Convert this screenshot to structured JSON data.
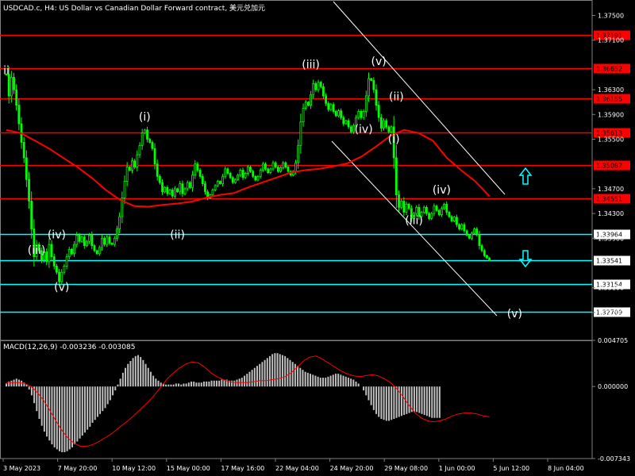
{
  "chart_data": [
    {
      "type": "candlestick",
      "title": "USDCAD.c, H4:  US Dollar vs Canadian Dollar Forward contract, 美元兑加元",
      "ylim": [
        1.3225,
        1.3775
      ],
      "y_ticks": [
        "1.37500",
        "1.37100",
        "1.36300",
        "1.35900",
        "1.35500",
        "1.34700",
        "1.34300",
        "1.33900",
        "1.33100",
        "1.32700"
      ],
      "x_ticks": [
        "3 May 2023",
        "7 May 20:00",
        "10 May 12:00",
        "15 May 00:00",
        "17 May 16:00",
        "22 May 04:00",
        "24 May 20:00",
        "29 May 08:00",
        "1 Jun 00:00",
        "5 Jun 12:00",
        "8 Jun 04:00"
      ],
      "colors": {
        "bull": "#00ff00",
        "bear": "#00ff00",
        "ma": "#ff0000",
        "red_level": "#ff0000",
        "cyan_level": "#00ffff",
        "arrow": "#00ffff",
        "trend": "#ffffff"
      },
      "h_levels": [
        {
          "value": 1.37191,
          "label": "1.37191",
          "color": "red"
        },
        {
          "value": 1.36652,
          "label": "1.36652",
          "color": "red"
        },
        {
          "value": 1.36155,
          "label": "1.36155",
          "color": "red"
        },
        {
          "value": 1.35613,
          "label": "1.35613",
          "color": "red"
        },
        {
          "value": 1.35087,
          "label": "1.35087",
          "color": "red"
        },
        {
          "value": 1.34551,
          "label": "1.34551",
          "color": "red"
        },
        {
          "value": 1.33964,
          "label": "1.33964",
          "color": "cyan"
        },
        {
          "value": 1.33541,
          "label": "1.33541",
          "color": "cyan"
        },
        {
          "value": 1.33154,
          "label": "1.33154",
          "color": "cyan"
        },
        {
          "value": 1.32709,
          "label": "1.32709",
          "color": "cyan"
        }
      ],
      "wave_labels": [
        {
          "text": "ii",
          "bar": 0,
          "price": 1.3655
        },
        {
          "text": "(i)",
          "bar": 55,
          "price": 1.358
        },
        {
          "text": "(ii)",
          "bar": 68,
          "price": 1.339
        },
        {
          "text": "(iii)",
          "bar": 12,
          "price": 1.3365
        },
        {
          "text": "(iv)",
          "bar": 20,
          "price": 1.339
        },
        {
          "text": "(v)",
          "bar": 22,
          "price": 1.3305
        },
        {
          "text": "(iii)",
          "bar": 121,
          "price": 1.3665
        },
        {
          "text": "(v)",
          "bar": 148,
          "price": 1.367
        },
        {
          "text": "(iv)",
          "bar": 142,
          "price": 1.356
        },
        {
          "text": "(ii)",
          "bar": 155,
          "price": 1.3613
        },
        {
          "text": "(i)",
          "bar": 154,
          "price": 1.3544
        },
        {
          "text": "(iv)",
          "bar": 173,
          "price": 1.3462
        },
        {
          "text": "(iii)",
          "bar": 162,
          "price": 1.3413
        },
        {
          "text": "(v)",
          "bar": 202,
          "price": 1.3262
        }
      ],
      "closes": [
        1.3655,
        1.362,
        1.365,
        1.363,
        1.3605,
        1.3575,
        1.3545,
        1.352,
        1.3485,
        1.345,
        1.3405,
        1.336,
        1.338,
        1.337,
        1.3355,
        1.3368,
        1.3352,
        1.338,
        1.336,
        1.3345,
        1.3335,
        1.332,
        1.3335,
        1.3345,
        1.336,
        1.3372,
        1.3365,
        1.338,
        1.3395,
        1.3385,
        1.3392,
        1.3378,
        1.3385,
        1.3395,
        1.3378,
        1.337,
        1.3365,
        1.3375,
        1.339,
        1.338,
        1.3392,
        1.3382,
        1.338,
        1.339,
        1.3405,
        1.3425,
        1.3455,
        1.3482,
        1.3505,
        1.35,
        1.3515,
        1.3505,
        1.3525,
        1.354,
        1.356,
        1.3565,
        1.355,
        1.3545,
        1.3535,
        1.351,
        1.349,
        1.348,
        1.3465,
        1.3472,
        1.3462,
        1.3468,
        1.3458,
        1.347,
        1.3465,
        1.3478,
        1.3462,
        1.347,
        1.348,
        1.3472,
        1.3492,
        1.351,
        1.35,
        1.349,
        1.3478,
        1.3465,
        1.3455,
        1.346,
        1.3468,
        1.3475,
        1.3482,
        1.3478,
        1.349,
        1.3502,
        1.3495,
        1.3488,
        1.348,
        1.3485,
        1.3492,
        1.35,
        1.3488,
        1.3495,
        1.3505,
        1.3498,
        1.349,
        1.3484,
        1.349,
        1.35,
        1.351,
        1.3502,
        1.3496,
        1.3502,
        1.3512,
        1.3505,
        1.3498,
        1.3504,
        1.3512,
        1.3505,
        1.3498,
        1.3492,
        1.3498,
        1.3512,
        1.354,
        1.3578,
        1.36,
        1.361,
        1.3605,
        1.3622,
        1.364,
        1.363,
        1.3642,
        1.3635,
        1.362,
        1.3608,
        1.3598,
        1.3606,
        1.3595,
        1.3588,
        1.3596,
        1.3585,
        1.3575,
        1.358,
        1.357,
        1.3562,
        1.3572,
        1.3585,
        1.3595,
        1.3585,
        1.3595,
        1.362,
        1.3648,
        1.3645,
        1.363,
        1.3605,
        1.3585,
        1.3568,
        1.358,
        1.357,
        1.3562,
        1.357,
        1.352,
        1.346,
        1.344,
        1.345,
        1.3432,
        1.3445,
        1.3438,
        1.3422,
        1.343,
        1.344,
        1.3425,
        1.3432,
        1.344,
        1.343,
        1.3422,
        1.343,
        1.3442,
        1.3435,
        1.3428,
        1.3438,
        1.3445,
        1.3432,
        1.3425,
        1.3418,
        1.3424,
        1.3412,
        1.3405,
        1.3412,
        1.3402,
        1.3395,
        1.339,
        1.3398,
        1.3405,
        1.3396,
        1.3378,
        1.337,
        1.3362,
        1.3358,
        1.3354
      ],
      "ma_series": [
        1.3565,
        1.356,
        1.3548,
        1.3535,
        1.352,
        1.3505,
        1.3488,
        1.3468,
        1.3452,
        1.3442,
        1.3441,
        1.3444,
        1.3446,
        1.3449,
        1.3455,
        1.346,
        1.3463,
        1.3472,
        1.348,
        1.3488,
        1.3496,
        1.35,
        1.3502,
        1.3506,
        1.3511,
        1.3522,
        1.3538,
        1.3555,
        1.3565,
        1.356,
        1.3548,
        1.352,
        1.35,
        1.3482,
        1.3458
      ]
    },
    {
      "type": "bar",
      "title": "MACD(12,26,9) -0.003236 -0.003085",
      "ylim": [
        -0.007343,
        0.004705
      ],
      "y_ticks": [
        "0.004705",
        "0.000000",
        "-0.007343"
      ],
      "signal_color": "#ff0000",
      "hist_color": "#c0c0c0",
      "values": [
        0.0003,
        0.0005,
        0.0006,
        0.0007,
        0.0008,
        0.0007,
        0.0006,
        0.0004,
        0.0002,
        -0.0003,
        -0.0009,
        -0.0017,
        -0.0025,
        -0.0033,
        -0.004,
        -0.0046,
        -0.0051,
        -0.0055,
        -0.0059,
        -0.0062,
        -0.0064,
        -0.0066,
        -0.0067,
        -0.0067,
        -0.0066,
        -0.0064,
        -0.0062,
        -0.0059,
        -0.0056,
        -0.0053,
        -0.005,
        -0.0047,
        -0.0044,
        -0.0041,
        -0.0037,
        -0.0034,
        -0.0031,
        -0.0028,
        -0.0025,
        -0.0022,
        -0.0018,
        -0.0014,
        -0.0009,
        -0.0004,
        0.0002,
        0.0008,
        0.0014,
        0.0019,
        0.0023,
        0.0026,
        0.0029,
        0.0031,
        0.0032,
        0.003,
        0.0027,
        0.0023,
        0.0019,
        0.0015,
        0.0011,
        0.0008,
        0.0006,
        0.0004,
        0.0003,
        0.0002,
        0.0002,
        0.0002,
        0.0002,
        0.0003,
        0.0003,
        0.0002,
        0.0003,
        0.0003,
        0.0004,
        0.0005,
        0.0005,
        0.0004,
        0.0004,
        0.0004,
        0.0005,
        0.0005,
        0.0005,
        0.0006,
        0.0006,
        0.0006,
        0.0006,
        0.0007,
        0.0007,
        0.0007,
        0.0006,
        0.0006,
        0.0006,
        0.0007,
        0.0008,
        0.0009,
        0.0011,
        0.0013,
        0.0015,
        0.0017,
        0.0019,
        0.0021,
        0.0023,
        0.0025,
        0.0027,
        0.0029,
        0.0031,
        0.0033,
        0.0034,
        0.0034,
        0.0033,
        0.0032,
        0.0031,
        0.0029,
        0.0027,
        0.0025,
        0.0023,
        0.0021,
        0.0019,
        0.0017,
        0.0015,
        0.0014,
        0.0013,
        0.0012,
        0.0011,
        0.001,
        0.0009,
        0.0009,
        0.0009,
        0.001,
        0.0011,
        0.0012,
        0.0013,
        0.0013,
        0.0012,
        0.0011,
        0.001,
        0.0009,
        0.0008,
        0.0007,
        0.0005,
        0.0003,
        0.0,
        -0.0004,
        -0.0009,
        -0.0014,
        -0.0019,
        -0.0024,
        -0.0028,
        -0.0031,
        -0.0033,
        -0.0034,
        -0.0035,
        -0.0035,
        -0.0034,
        -0.0033,
        -0.0032,
        -0.0031,
        -0.003,
        -0.0029,
        -0.0028,
        -0.0027,
        -0.0026,
        -0.0026,
        -0.0026,
        -0.0027,
        -0.0028,
        -0.0029,
        -0.003,
        -0.0031,
        -0.0032,
        -0.0032,
        -0.0032,
        -0.0032
      ],
      "signal": [
        0.0004,
        0.0004,
        0.0004,
        0.0003,
        0.0,
        -0.0006,
        -0.0014,
        -0.0024,
        -0.0035,
        -0.0045,
        -0.0053,
        -0.0058,
        -0.0061,
        -0.0061,
        -0.0059,
        -0.0056,
        -0.0052,
        -0.0048,
        -0.0043,
        -0.0038,
        -0.0033,
        -0.0027,
        -0.0021,
        -0.0015,
        -0.0008,
        0.0,
        0.0008,
        0.0014,
        0.0019,
        0.0023,
        0.0025,
        0.0024,
        0.002,
        0.0014,
        0.001,
        0.0007,
        0.0005,
        0.0004,
        0.0004,
        0.0004,
        0.0005,
        0.0006,
        0.0006,
        0.0007,
        0.0008,
        0.001,
        0.0014,
        0.002,
        0.0026,
        0.003,
        0.0031,
        0.0028,
        0.0024,
        0.002,
        0.0016,
        0.0013,
        0.0011,
        0.001,
        0.0011,
        0.0012,
        0.0011,
        0.0008,
        0.0004,
        -0.0002,
        -0.001,
        -0.0019,
        -0.0027,
        -0.0032,
        -0.0035,
        -0.0036,
        -0.0035,
        -0.0033,
        -0.003,
        -0.0028,
        -0.0027,
        -0.0027,
        -0.0028,
        -0.003,
        -0.0031
      ]
    }
  ]
}
